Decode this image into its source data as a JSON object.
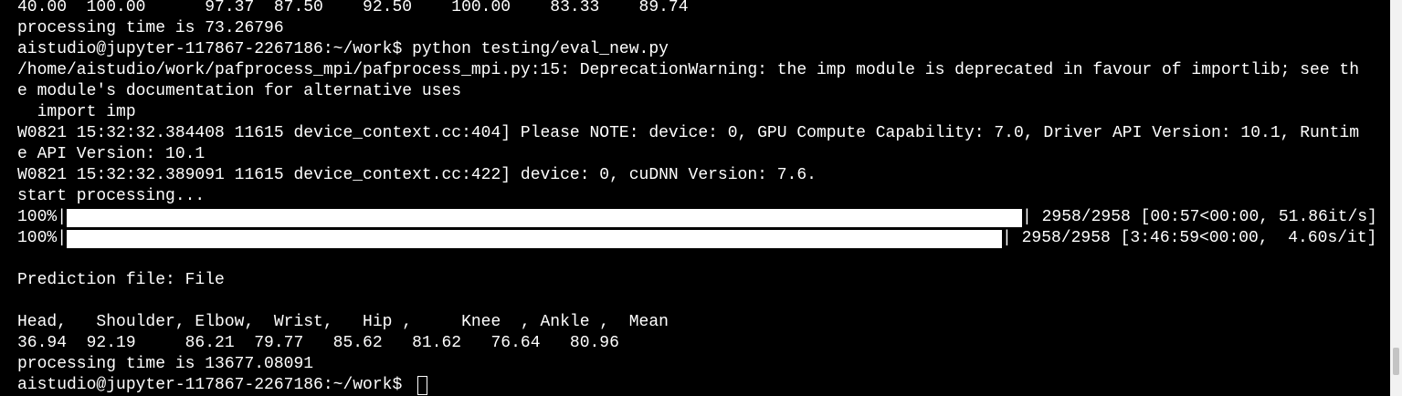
{
  "terminal": {
    "lines": [
      "40.00  100.00      97.37  87.50    92.50    100.00    83.33    89.74",
      "processing time is 73.26796",
      "aistudio@jupyter-117867-2267186:~/work$ python testing/eval_new.py",
      "/home/aistudio/work/pafprocess_mpi/pafprocess_mpi.py:15: DeprecationWarning: the imp module is deprecated in favour of importlib; see th",
      "e module's documentation for alternative uses",
      "  import imp",
      "W0821 15:32:32.384408 11615 device_context.cc:404] Please NOTE: device: 0, GPU Compute Capability: 7.0, Driver API Version: 10.1, Runtim",
      "e API Version: 10.1",
      "W0821 15:32:32.389091 11615 device_context.cc:422] device: 0, cuDNN Version: 7.6.",
      "start processing..."
    ],
    "progress": [
      {
        "prefix": "100%|",
        "suffix": "| 2958/2958 [00:57<00:00, 51.86it/s]",
        "fraction": 1.0
      },
      {
        "prefix": "100%|",
        "suffix": "| 2958/2958 [3:46:59<00:00,  4.60s/it]",
        "fraction": 1.0
      }
    ],
    "prediction_line": "Prediction file: File",
    "header_line": "Head,   Shoulder, Elbow,  Wrist,   Hip ,     Knee  , Ankle ,  Mean",
    "values_line": "36.94  92.19     86.21  79.77   85.62   81.62   76.64   80.96",
    "time_line": "processing time is 13677.08091",
    "prompt": "aistudio@jupyter-117867-2267186:~/work$ "
  },
  "colors": {
    "background": "#000000",
    "foreground": "#ffffff",
    "scrollbar": "#f2f2f2",
    "scroll_thumb": "#c4c4c4"
  }
}
